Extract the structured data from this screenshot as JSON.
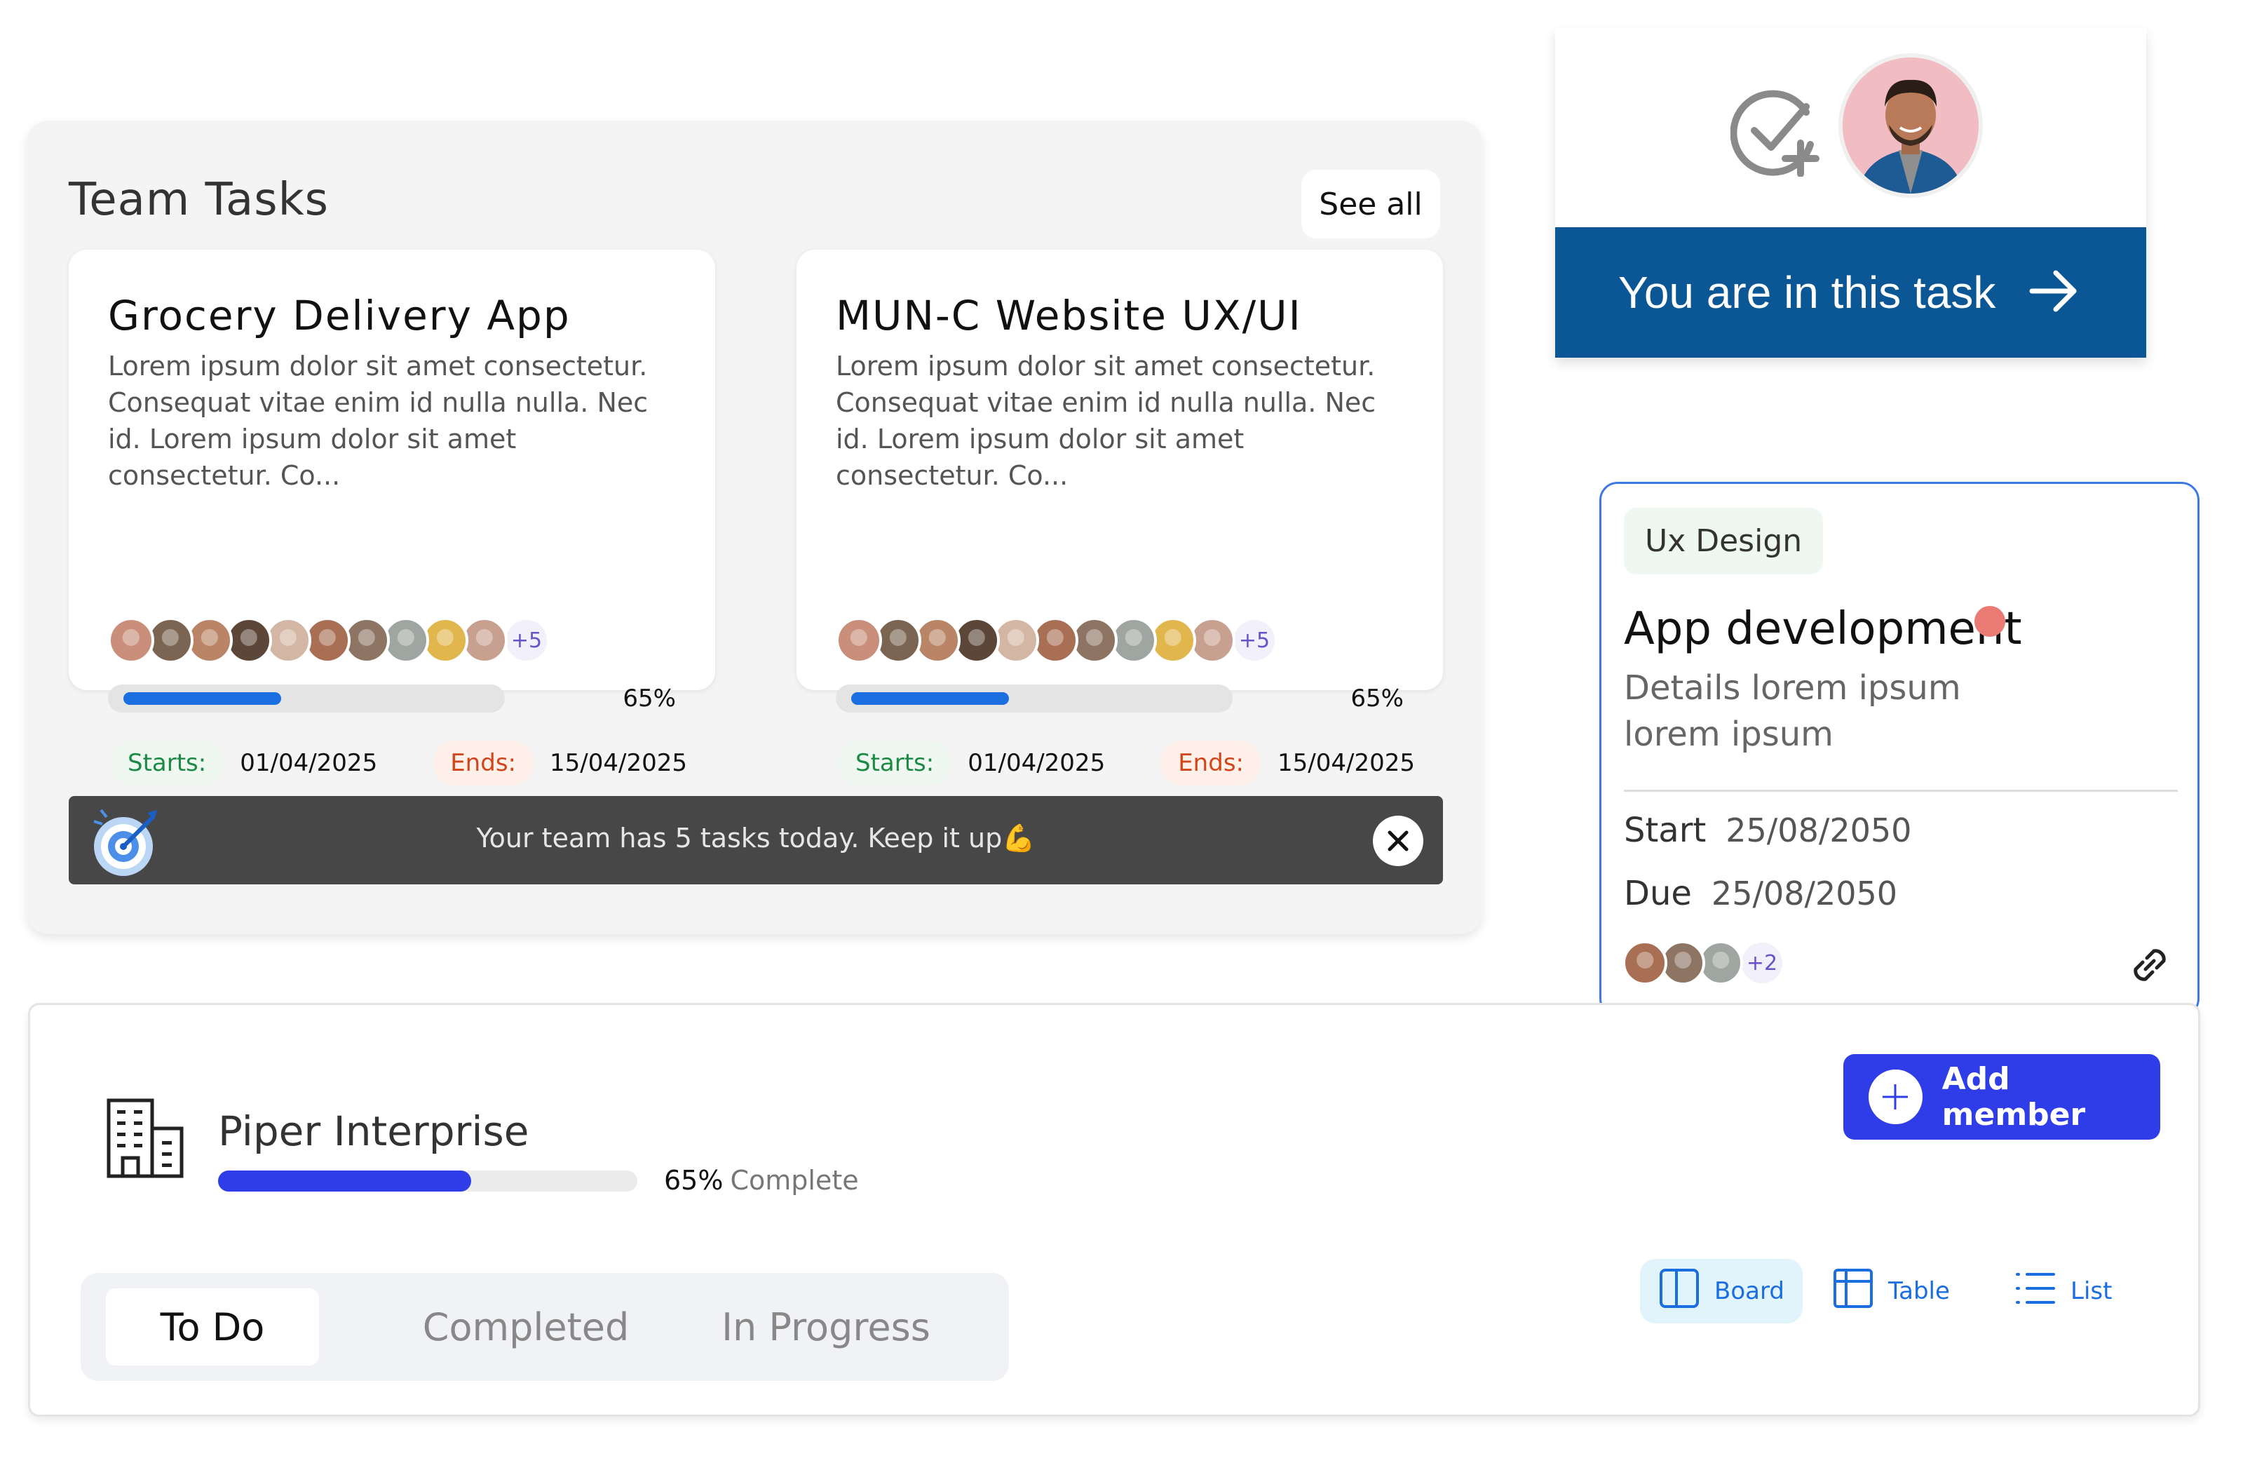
{
  "team_tasks": {
    "title": "Team Tasks",
    "see_all_label": "See all",
    "cards": [
      {
        "title": "Grocery Delivery App",
        "description": "Lorem ipsum dolor sit amet consectetur. Consequat vitae enim id nulla nulla. Nec id. Lorem ipsum dolor sit amet consectetur. Co...",
        "extra_members": "+5",
        "progress": 0.65,
        "progress_label": "65%",
        "starts_label": "Starts:",
        "starts": "01/04/2025",
        "ends_label": "Ends:",
        "ends": "15/04/2025"
      },
      {
        "title": "MUN-C Website UX/UI",
        "description": "Lorem ipsum dolor sit amet consectetur. Consequat vitae enim id nulla nulla. Nec id. Lorem ipsum dolor sit amet consectetur. Co...",
        "extra_members": "+5",
        "progress": 0.65,
        "progress_label": "65%",
        "starts_label": "Starts:",
        "starts": "01/04/2025",
        "ends_label": "Ends:",
        "ends": "15/04/2025"
      }
    ],
    "banner_text": "Your team has 5 tasks today. Keep it up💪"
  },
  "join_card": {
    "cta_label": "You are in this task"
  },
  "app_card": {
    "tag": "Ux Design",
    "title": "App development",
    "description": "Details lorem ipsum lorem ipsum",
    "start_label": "Start",
    "start_date": "25/08/2050",
    "due_label": "Due",
    "due_date": "25/08/2050",
    "extra_members": "+2"
  },
  "project": {
    "name": "Piper Interprise",
    "progress": 0.65,
    "progress_pct": "65%",
    "progress_suffix": "Complete",
    "add_member_label": "Add member",
    "tabs": [
      "To Do",
      "Completed",
      "In Progress"
    ],
    "active_tab": "To Do",
    "views": [
      "Board",
      "Table",
      "List"
    ],
    "active_view": "Board"
  },
  "colors": {
    "primary_blue": "#1a6ee0",
    "indigo": "#2f3de8",
    "navy": "#0b5694",
    "start_green": "#1c8a45",
    "end_orange": "#d2451b",
    "dot_red": "#ea7a74"
  },
  "avatar_colors": [
    "#c98f7a",
    "#7b6552",
    "#b98566",
    "#5b4638",
    "#d3b7a4",
    "#a86f55",
    "#8d7463",
    "#9fa6a2",
    "#e0b64d",
    "#c8a090"
  ]
}
